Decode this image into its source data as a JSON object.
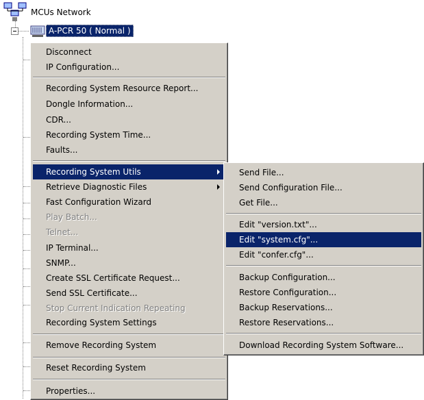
{
  "tree": {
    "root_label": "MCUs Network",
    "node_label": "A-PCR 50  ( Normal )"
  },
  "context_menu": {
    "items": [
      "Disconnect",
      "IP Configuration...",
      "Recording System Resource Report...",
      "Dongle Information...",
      "CDR...",
      "Recording System Time...",
      "Faults...",
      "Recording System Utils",
      "Retrieve Diagnostic Files",
      "Fast Configuration Wizard",
      "Play Batch...",
      "Telnet...",
      "IP Terminal...",
      "SNMP...",
      "Create SSL Certificate Request...",
      "Send SSL Certificate...",
      "Stop Current Indication Repeating",
      "Recording System Settings",
      "Remove Recording System",
      "Reset Recording System",
      "Properties..."
    ]
  },
  "submenu": {
    "items": [
      "Send File...",
      "Send Configuration File...",
      "Get File...",
      "Edit \"version.txt\"...",
      "Edit \"system.cfg\"...",
      "Edit \"confer.cfg\"...",
      "Backup Configuration...",
      "Restore Configuration...",
      "Backup Reservations...",
      "Restore Reservations...",
      "Download Recording System Software..."
    ]
  },
  "colors": {
    "menu_bg": "#d4d0c8",
    "highlight": "#0a246a",
    "disabled_text": "#808080"
  },
  "icons": [
    "network-icon",
    "collapse-icon",
    "mcu-device-icon",
    "submenu-arrow-icon"
  ]
}
